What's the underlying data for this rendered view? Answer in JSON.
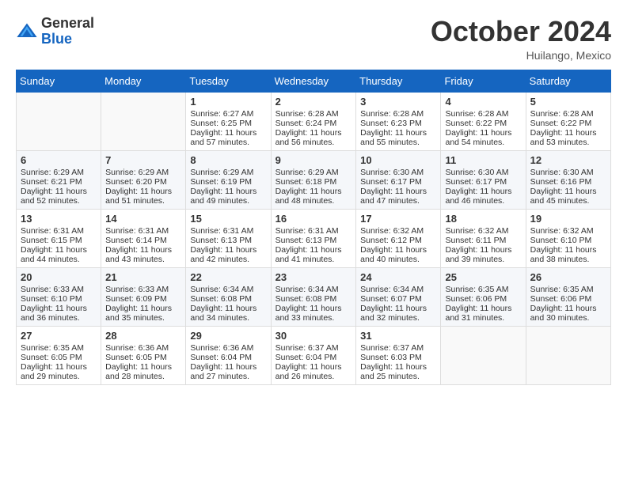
{
  "header": {
    "logo_general": "General",
    "logo_blue": "Blue",
    "month_title": "October 2024",
    "location": "Huilango, Mexico"
  },
  "days_of_week": [
    "Sunday",
    "Monday",
    "Tuesday",
    "Wednesday",
    "Thursday",
    "Friday",
    "Saturday"
  ],
  "weeks": [
    [
      {
        "day": "",
        "empty": true
      },
      {
        "day": "",
        "empty": true
      },
      {
        "day": "1",
        "sunrise": "Sunrise: 6:27 AM",
        "sunset": "Sunset: 6:25 PM",
        "daylight": "Daylight: 11 hours and 57 minutes."
      },
      {
        "day": "2",
        "sunrise": "Sunrise: 6:28 AM",
        "sunset": "Sunset: 6:24 PM",
        "daylight": "Daylight: 11 hours and 56 minutes."
      },
      {
        "day": "3",
        "sunrise": "Sunrise: 6:28 AM",
        "sunset": "Sunset: 6:23 PM",
        "daylight": "Daylight: 11 hours and 55 minutes."
      },
      {
        "day": "4",
        "sunrise": "Sunrise: 6:28 AM",
        "sunset": "Sunset: 6:22 PM",
        "daylight": "Daylight: 11 hours and 54 minutes."
      },
      {
        "day": "5",
        "sunrise": "Sunrise: 6:28 AM",
        "sunset": "Sunset: 6:22 PM",
        "daylight": "Daylight: 11 hours and 53 minutes."
      }
    ],
    [
      {
        "day": "6",
        "sunrise": "Sunrise: 6:29 AM",
        "sunset": "Sunset: 6:21 PM",
        "daylight": "Daylight: 11 hours and 52 minutes."
      },
      {
        "day": "7",
        "sunrise": "Sunrise: 6:29 AM",
        "sunset": "Sunset: 6:20 PM",
        "daylight": "Daylight: 11 hours and 51 minutes."
      },
      {
        "day": "8",
        "sunrise": "Sunrise: 6:29 AM",
        "sunset": "Sunset: 6:19 PM",
        "daylight": "Daylight: 11 hours and 49 minutes."
      },
      {
        "day": "9",
        "sunrise": "Sunrise: 6:29 AM",
        "sunset": "Sunset: 6:18 PM",
        "daylight": "Daylight: 11 hours and 48 minutes."
      },
      {
        "day": "10",
        "sunrise": "Sunrise: 6:30 AM",
        "sunset": "Sunset: 6:17 PM",
        "daylight": "Daylight: 11 hours and 47 minutes."
      },
      {
        "day": "11",
        "sunrise": "Sunrise: 6:30 AM",
        "sunset": "Sunset: 6:17 PM",
        "daylight": "Daylight: 11 hours and 46 minutes."
      },
      {
        "day": "12",
        "sunrise": "Sunrise: 6:30 AM",
        "sunset": "Sunset: 6:16 PM",
        "daylight": "Daylight: 11 hours and 45 minutes."
      }
    ],
    [
      {
        "day": "13",
        "sunrise": "Sunrise: 6:31 AM",
        "sunset": "Sunset: 6:15 PM",
        "daylight": "Daylight: 11 hours and 44 minutes."
      },
      {
        "day": "14",
        "sunrise": "Sunrise: 6:31 AM",
        "sunset": "Sunset: 6:14 PM",
        "daylight": "Daylight: 11 hours and 43 minutes."
      },
      {
        "day": "15",
        "sunrise": "Sunrise: 6:31 AM",
        "sunset": "Sunset: 6:13 PM",
        "daylight": "Daylight: 11 hours and 42 minutes."
      },
      {
        "day": "16",
        "sunrise": "Sunrise: 6:31 AM",
        "sunset": "Sunset: 6:13 PM",
        "daylight": "Daylight: 11 hours and 41 minutes."
      },
      {
        "day": "17",
        "sunrise": "Sunrise: 6:32 AM",
        "sunset": "Sunset: 6:12 PM",
        "daylight": "Daylight: 11 hours and 40 minutes."
      },
      {
        "day": "18",
        "sunrise": "Sunrise: 6:32 AM",
        "sunset": "Sunset: 6:11 PM",
        "daylight": "Daylight: 11 hours and 39 minutes."
      },
      {
        "day": "19",
        "sunrise": "Sunrise: 6:32 AM",
        "sunset": "Sunset: 6:10 PM",
        "daylight": "Daylight: 11 hours and 38 minutes."
      }
    ],
    [
      {
        "day": "20",
        "sunrise": "Sunrise: 6:33 AM",
        "sunset": "Sunset: 6:10 PM",
        "daylight": "Daylight: 11 hours and 36 minutes."
      },
      {
        "day": "21",
        "sunrise": "Sunrise: 6:33 AM",
        "sunset": "Sunset: 6:09 PM",
        "daylight": "Daylight: 11 hours and 35 minutes."
      },
      {
        "day": "22",
        "sunrise": "Sunrise: 6:34 AM",
        "sunset": "Sunset: 6:08 PM",
        "daylight": "Daylight: 11 hours and 34 minutes."
      },
      {
        "day": "23",
        "sunrise": "Sunrise: 6:34 AM",
        "sunset": "Sunset: 6:08 PM",
        "daylight": "Daylight: 11 hours and 33 minutes."
      },
      {
        "day": "24",
        "sunrise": "Sunrise: 6:34 AM",
        "sunset": "Sunset: 6:07 PM",
        "daylight": "Daylight: 11 hours and 32 minutes."
      },
      {
        "day": "25",
        "sunrise": "Sunrise: 6:35 AM",
        "sunset": "Sunset: 6:06 PM",
        "daylight": "Daylight: 11 hours and 31 minutes."
      },
      {
        "day": "26",
        "sunrise": "Sunrise: 6:35 AM",
        "sunset": "Sunset: 6:06 PM",
        "daylight": "Daylight: 11 hours and 30 minutes."
      }
    ],
    [
      {
        "day": "27",
        "sunrise": "Sunrise: 6:35 AM",
        "sunset": "Sunset: 6:05 PM",
        "daylight": "Daylight: 11 hours and 29 minutes."
      },
      {
        "day": "28",
        "sunrise": "Sunrise: 6:36 AM",
        "sunset": "Sunset: 6:05 PM",
        "daylight": "Daylight: 11 hours and 28 minutes."
      },
      {
        "day": "29",
        "sunrise": "Sunrise: 6:36 AM",
        "sunset": "Sunset: 6:04 PM",
        "daylight": "Daylight: 11 hours and 27 minutes."
      },
      {
        "day": "30",
        "sunrise": "Sunrise: 6:37 AM",
        "sunset": "Sunset: 6:04 PM",
        "daylight": "Daylight: 11 hours and 26 minutes."
      },
      {
        "day": "31",
        "sunrise": "Sunrise: 6:37 AM",
        "sunset": "Sunset: 6:03 PM",
        "daylight": "Daylight: 11 hours and 25 minutes."
      },
      {
        "day": "",
        "empty": true
      },
      {
        "day": "",
        "empty": true
      }
    ]
  ]
}
